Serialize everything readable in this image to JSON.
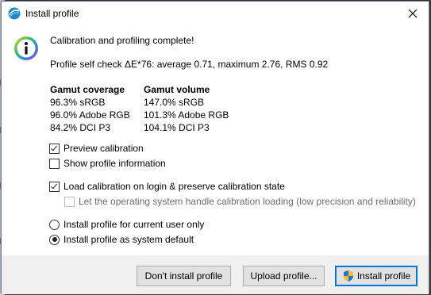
{
  "window": {
    "title": "Install profile"
  },
  "message": {
    "headline": "Calibration and profiling complete!",
    "self_check": "Profile self check ΔE*76: average 0.71, maximum 2.76, RMS 0.92"
  },
  "gamut": {
    "coverage_header": "Gamut coverage",
    "volume_header": "Gamut volume",
    "coverage": [
      "96.3% sRGB",
      "96.0% Adobe RGB",
      "84.2% DCI P3"
    ],
    "volume": [
      "147.0% sRGB",
      "101.3% Adobe RGB",
      "104.1% DCI P3"
    ]
  },
  "options": {
    "preview_calibration": {
      "label": "Preview calibration",
      "checked": true
    },
    "show_profile_info": {
      "label": "Show profile information",
      "checked": false
    },
    "load_calibration": {
      "label": "Load calibration on login & preserve calibration state",
      "checked": true
    },
    "os_handle_loading": {
      "label": "Let the operating system handle calibration loading (low precision and reliability)",
      "checked": false,
      "disabled": true
    }
  },
  "install_scope": {
    "current_user": {
      "label": "Install profile for current user only",
      "selected": false
    },
    "system_default": {
      "label": "Install profile as system default",
      "selected": true
    }
  },
  "buttons": {
    "dont_install": "Don't install profile",
    "upload": "Upload profile...",
    "install": "Install profile"
  },
  "icons": {
    "app": "app-logo-icon",
    "info": "info-icon",
    "close": "close-icon",
    "shield": "uac-shield-icon"
  },
  "colors": {
    "accent_border": "#0078d7",
    "info_ring": "#9a3fd4"
  }
}
